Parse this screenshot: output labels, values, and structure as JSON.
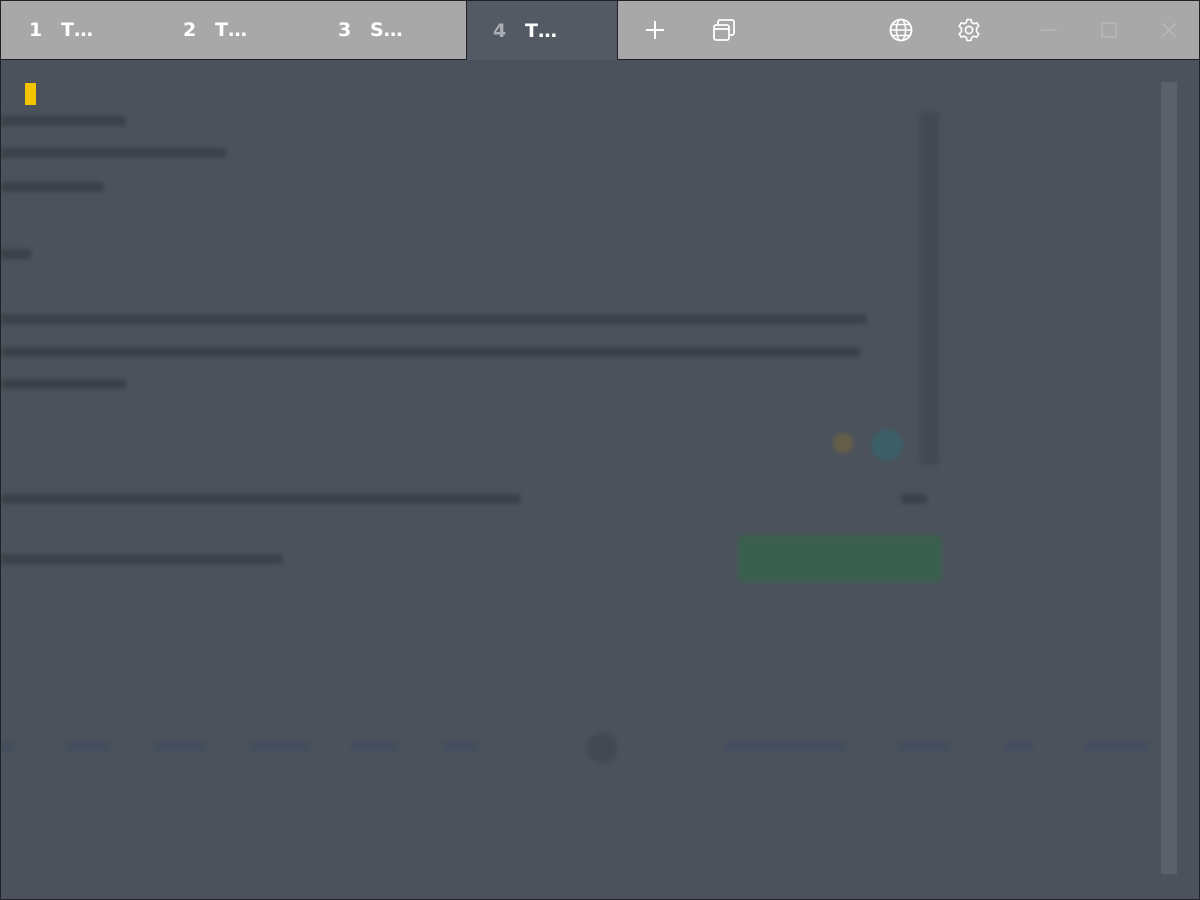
{
  "tabs": [
    {
      "number": "1",
      "title": "T…",
      "active": false
    },
    {
      "number": "2",
      "title": "T…",
      "active": false
    },
    {
      "number": "3",
      "title": "S…",
      "active": false
    },
    {
      "number": "4",
      "title": "T…",
      "active": true
    }
  ],
  "toolbar": {
    "new_tab_icon": "plus-icon",
    "duplicate_icon": "duplicate-window-icon",
    "globe_icon": "globe-icon",
    "settings_icon": "gear-icon"
  },
  "window_controls": {
    "minimize_icon": "minimize-icon",
    "maximize_icon": "maximize-icon",
    "close_icon": "close-icon"
  },
  "colors": {
    "titlebar": "#a8a8a8",
    "active_tab": "#545a63",
    "terminal_bg": "#4c525b",
    "cursor": "#f5c400",
    "scrollbar": "#5b616a"
  }
}
